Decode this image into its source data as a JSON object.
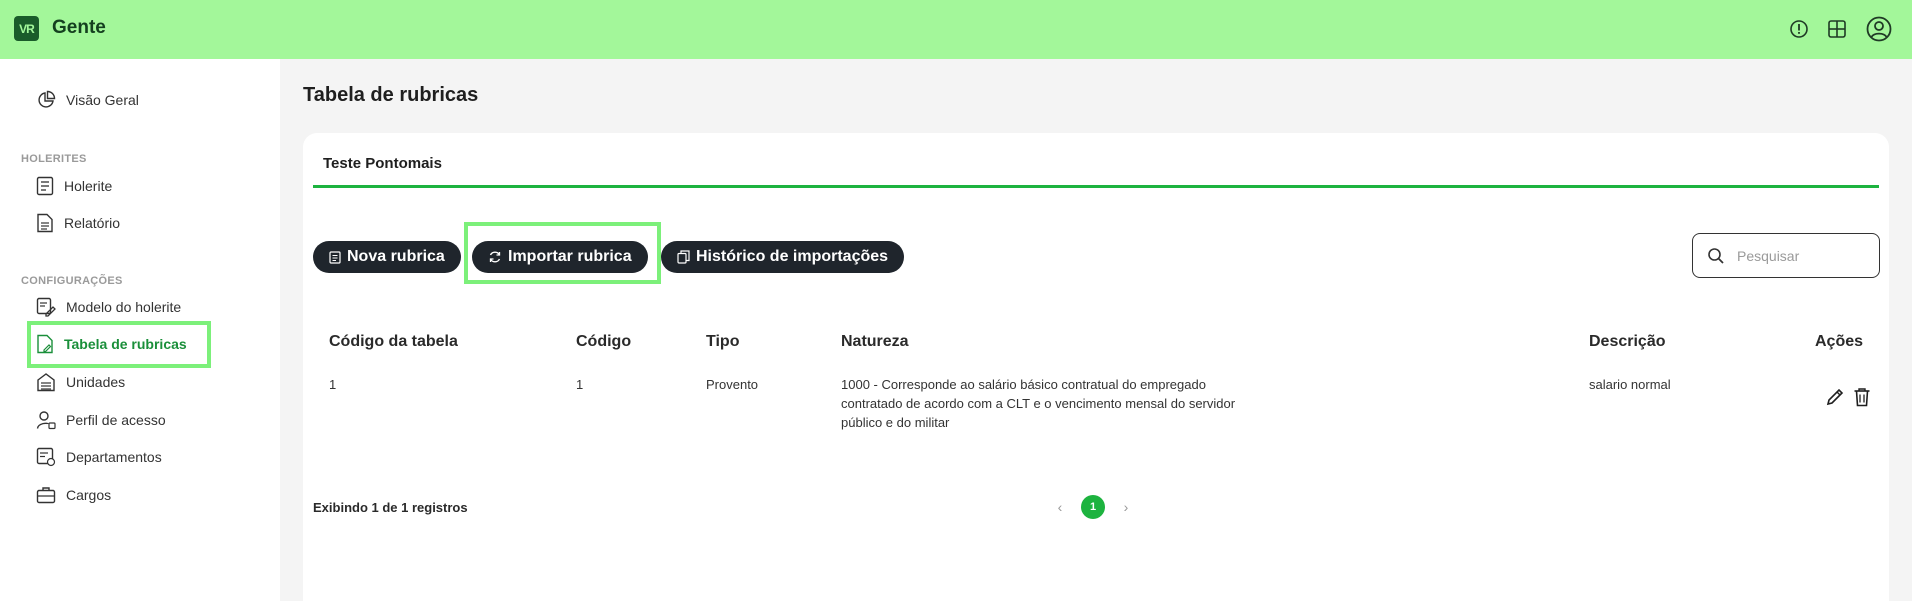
{
  "app": {
    "logo_text": "VR",
    "brand": "Gente"
  },
  "topbar": {
    "icons": [
      "info-icon",
      "apps-grid-icon",
      "user-account-icon"
    ]
  },
  "sidebar": {
    "overview": "Visão Geral",
    "section_holerites": "HOLERITES",
    "holerite": "Holerite",
    "relatorio": "Relatório",
    "section_config": "CONFIGURAÇÕES",
    "modelo": "Modelo do holerite",
    "tabela": "Tabela de rubricas",
    "unidades": "Unidades",
    "perfil": "Perfil de acesso",
    "departamentos": "Departamentos",
    "cargos": "Cargos"
  },
  "page": {
    "title": "Tabela de rubricas"
  },
  "tabs": {
    "active": "Teste Pontomais"
  },
  "toolbar": {
    "nova": "Nova rubrica",
    "importar": "Importar rubrica",
    "historico": "Histórico de importações",
    "search_placeholder": "Pesquisar"
  },
  "table": {
    "headers": {
      "codigo_tabela": "Código da tabela",
      "codigo": "Código",
      "tipo": "Tipo",
      "natureza": "Natureza",
      "descricao": "Descrição",
      "acoes": "Ações"
    },
    "rows": [
      {
        "codigo_tabela": "1",
        "codigo": "1",
        "tipo": "Provento",
        "natureza_l1": "1000 - Corresponde ao salário básico contratual do empregado",
        "natureza_l2": "contratado de acordo com a CLT e o vencimento mensal do servidor",
        "natureza_l3": "público e do militar",
        "descricao": "salario normal"
      }
    ]
  },
  "footer": {
    "count": "Exibindo 1 de 1 registros",
    "current_page": "1",
    "prev": "‹",
    "next": "›"
  },
  "colors": {
    "topbar": "#a3f79a",
    "accent": "#1db33f",
    "button": "#1f252c",
    "highlight": "#7cf07a"
  }
}
